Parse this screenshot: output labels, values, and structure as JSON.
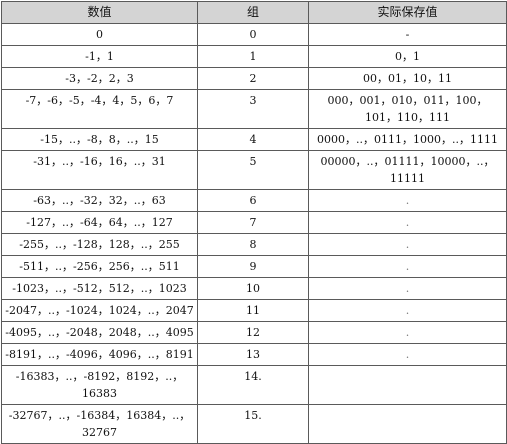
{
  "headers": [
    "数值",
    "组",
    "实际保存值"
  ],
  "rows": [
    {
      "values": "0",
      "group": "0",
      "saved": "-"
    },
    {
      "values": "-1，1",
      "group": "1",
      "saved": "0，1"
    },
    {
      "values": "-3，-2，2，3",
      "group": "2",
      "saved": "00，01，10，11"
    },
    {
      "values": "-7，-6，-5，-4，4，5，6，7",
      "group": "3",
      "saved": "000，001，010，011，100，101，110，111"
    },
    {
      "values": "-15，..，-8，8，..，15",
      "group": "4",
      "saved": "0000，..，0111，1000，..，1111"
    },
    {
      "values": "-31，..，-16，16，..，31",
      "group": "5",
      "saved": "00000，..，01111，10000，..，11111"
    },
    {
      "values": "-63，..，-32，32，..，63",
      "group": "6",
      "saved": "."
    },
    {
      "values": "-127，..，-64，64，..，127",
      "group": "7",
      "saved": "."
    },
    {
      "values": "-255，..，-128，128，..，255",
      "group": "8",
      "saved": "."
    },
    {
      "values": "-511，..，-256，256，..，511",
      "group": "9",
      "saved": "."
    },
    {
      "values": "-1023，..，-512，512，..，1023",
      "group": "10",
      "saved": "."
    },
    {
      "values": "-2047，..，-1024，1024，..，2047",
      "group": "11",
      "saved": "."
    },
    {
      "values": "-4095，..，-2048，2048，..，4095",
      "group": "12",
      "saved": "."
    },
    {
      "values": "-8191，..，-4096，4096，..，8191",
      "group": "13",
      "saved": "."
    },
    {
      "values": "-16383，..，-8192，8192，..，16383",
      "group": "14.",
      "saved": ""
    },
    {
      "values": "-32767，..，-16384，16384，..，32767",
      "group": "15.",
      "saved": ""
    }
  ]
}
